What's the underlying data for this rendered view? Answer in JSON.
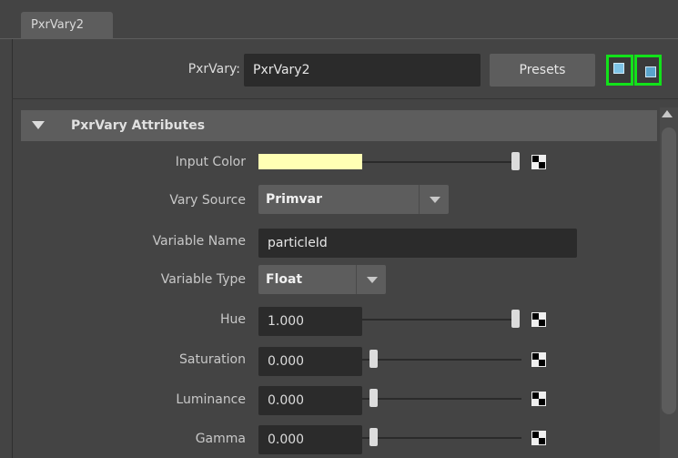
{
  "tab": {
    "label": "PxrVary2"
  },
  "header": {
    "node_label": "PxrVary:",
    "node_name": "PxrVary2",
    "presets_label": "Presets"
  },
  "section": {
    "title": "PxrVary Attributes"
  },
  "attributes": {
    "input_color": {
      "label": "Input Color",
      "color": "#ffffb4"
    },
    "vary_source": {
      "label": "Vary Source",
      "value": "Primvar"
    },
    "variable_name": {
      "label": "Variable Name",
      "value": "particleId"
    },
    "variable_type": {
      "label": "Variable Type",
      "value": "Float"
    },
    "hue": {
      "label": "Hue",
      "value": "1.000"
    },
    "saturation": {
      "label": "Saturation",
      "value": "0.000"
    },
    "luminance": {
      "label": "Luminance",
      "value": "0.000"
    },
    "gamma": {
      "label": "Gamma",
      "value": "0.000"
    }
  },
  "colors": {
    "accent_bracket": "#12e21a",
    "panel_bg": "#444444",
    "field_bg": "#2b2b2b"
  }
}
